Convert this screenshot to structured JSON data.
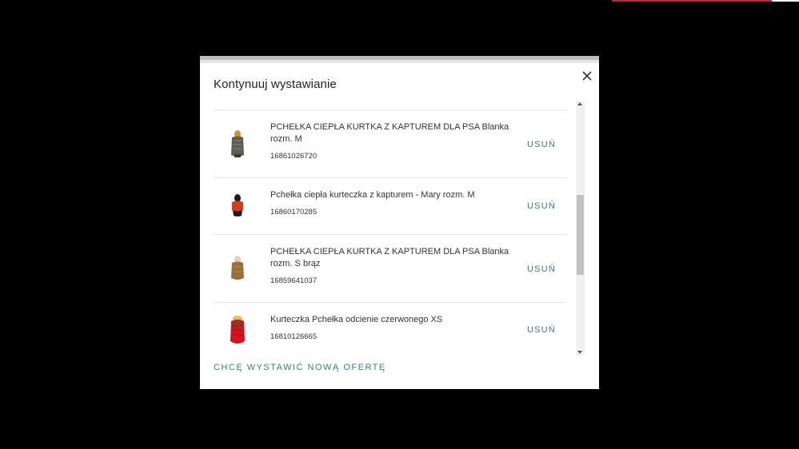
{
  "colors": {
    "accent": "#377f86",
    "overlay": "#000000",
    "modal_bg": "#ffffff"
  },
  "modal": {
    "title": "Kontynuuj wystawianie",
    "close_icon": "close-icon",
    "items": [
      {
        "title": "PCHEŁKA CIEPŁA KURTKA Z KAPTUREM DLA PSA Blanka rozm. M",
        "id": "16861026720",
        "remove_label": "USUŃ",
        "thumb_icon": "dog-jacket-grey-icon"
      },
      {
        "title": "Pchełka ciepła kurteczka z kapturem - Mary rozm. M",
        "id": "16860170285",
        "remove_label": "USUŃ",
        "thumb_icon": "dog-jacket-black-red-icon"
      },
      {
        "title": "PCHEŁKA CIEPŁA KURTKA Z KAPTUREM DLA PSA Blanka rozm. S brąz",
        "id": "16859641037",
        "remove_label": "USUŃ",
        "thumb_icon": "dog-jacket-brown-icon"
      },
      {
        "title": "Kurteczka Pchełka odcienie czerwonego XS",
        "id": "16810126665",
        "remove_label": "USUŃ",
        "thumb_icon": "dog-jacket-red-icon"
      }
    ],
    "new_offer_label": "CHCĘ WYSTAWIĆ NOWĄ OFERTĘ"
  }
}
